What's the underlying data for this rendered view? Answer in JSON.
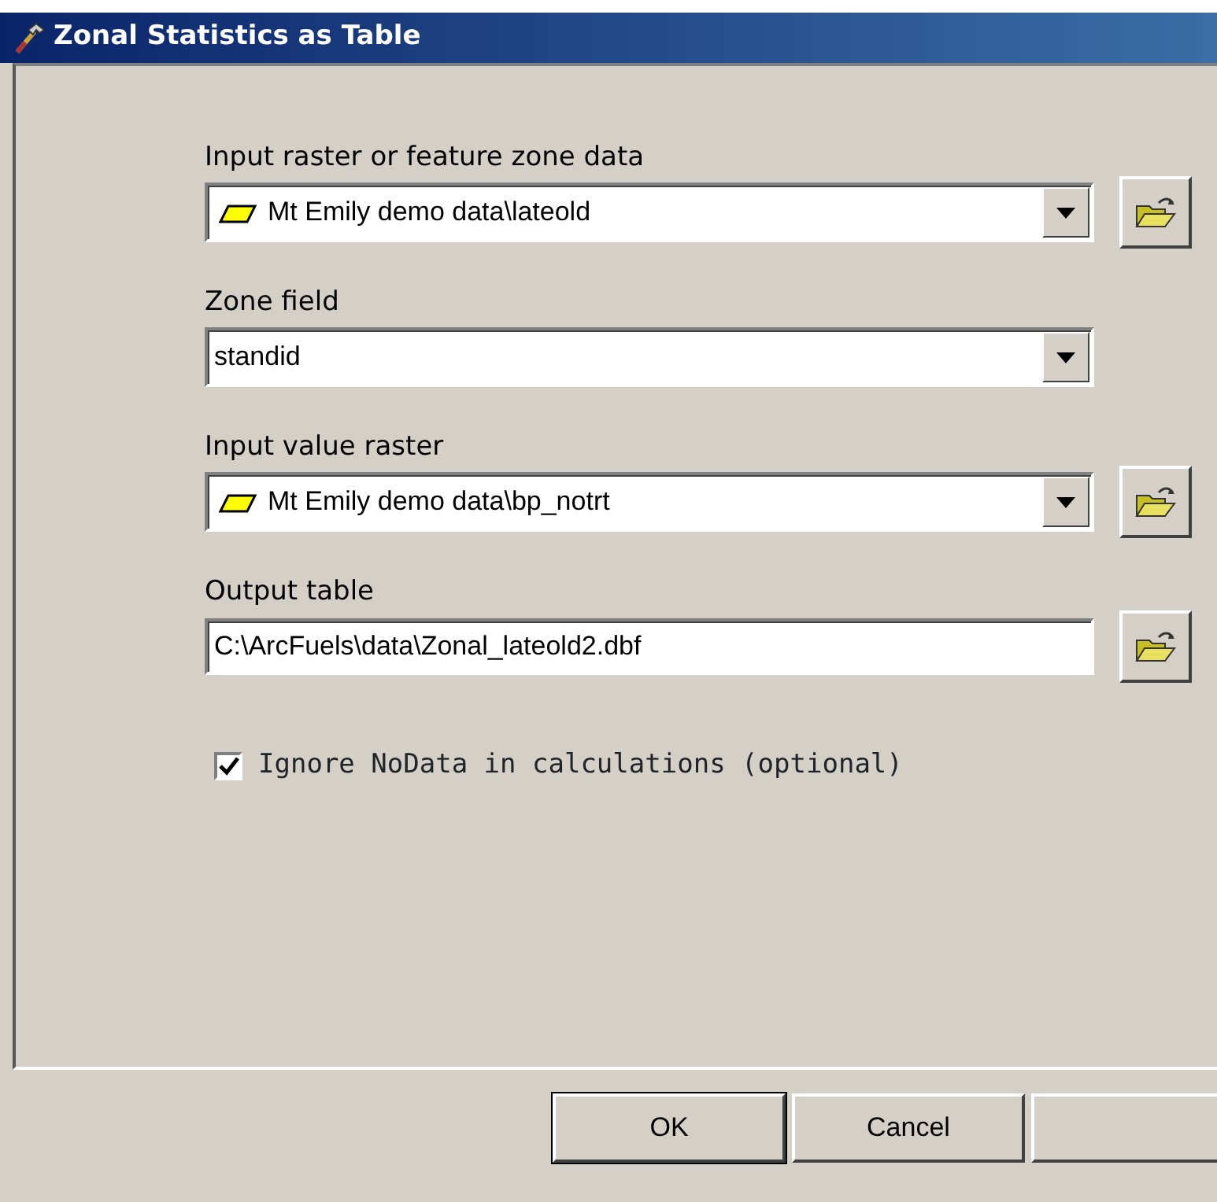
{
  "window": {
    "title": "Zonal Statistics as Table"
  },
  "parameters": [
    {
      "label": "Input raster or feature zone data",
      "kind": "combo",
      "value": "Mt Emily demo data\\lateold",
      "layer_icon": true,
      "browse": true
    },
    {
      "label": "Zone field",
      "kind": "combo",
      "value": "standid",
      "layer_icon": false,
      "browse": false
    },
    {
      "label": "Input value raster",
      "kind": "combo",
      "value": "Mt Emily demo data\\bp_notrt",
      "layer_icon": true,
      "browse": true
    },
    {
      "label": "Output table",
      "kind": "text",
      "value": "C:\\ArcFuels\\data\\Zonal_lateold2.dbf",
      "layer_icon": false,
      "browse": true
    }
  ],
  "option": {
    "label": "Ignore NoData in calculations (optional)",
    "checked": true
  },
  "buttons": [
    {
      "label": "OK",
      "default": true
    },
    {
      "label": "Cancel",
      "default": false
    }
  ]
}
